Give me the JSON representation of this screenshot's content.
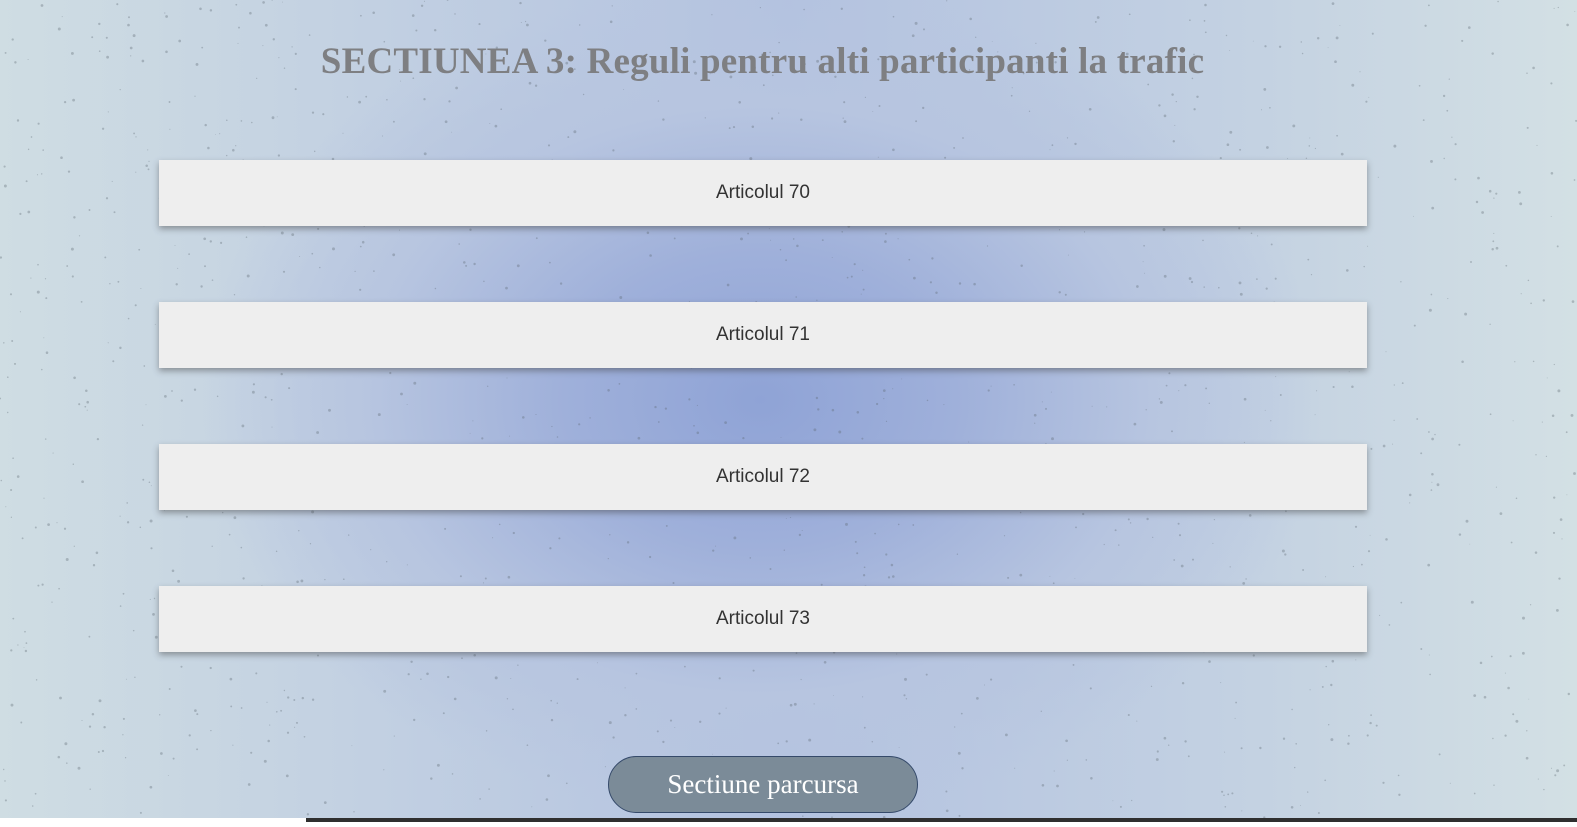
{
  "section": {
    "title": "SECTIUNEA 3: Reguli pentru alti participanti la trafic"
  },
  "articles": [
    {
      "label": "Articolul 70"
    },
    {
      "label": "Articolul 71"
    },
    {
      "label": "Articolul 72"
    },
    {
      "label": "Articolul 73"
    }
  ],
  "actions": {
    "done_label": "Sectiune parcursa"
  },
  "colors": {
    "title": "#7e7f82",
    "article_bg": "#eeeeee",
    "button_bg": "#7b8b98",
    "button_border": "#354a6a"
  }
}
